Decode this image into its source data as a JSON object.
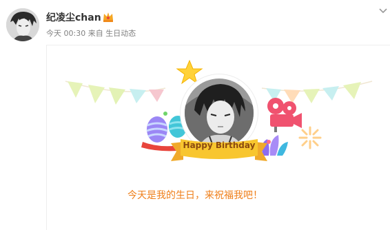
{
  "post": {
    "username": "纪凌尘chan",
    "time": "今天 00:30",
    "source": "来自 生日动态"
  },
  "card": {
    "banner_text": "Happy Birthday",
    "message": "今天是我的生日，来祝福我吧！"
  },
  "colors": {
    "message": "#ef7f1a",
    "banner": "#f8c62f",
    "pennants": [
      "#e6f3b8",
      "#ffdcb8",
      "#f6c7cf",
      "#c7eff0"
    ]
  }
}
